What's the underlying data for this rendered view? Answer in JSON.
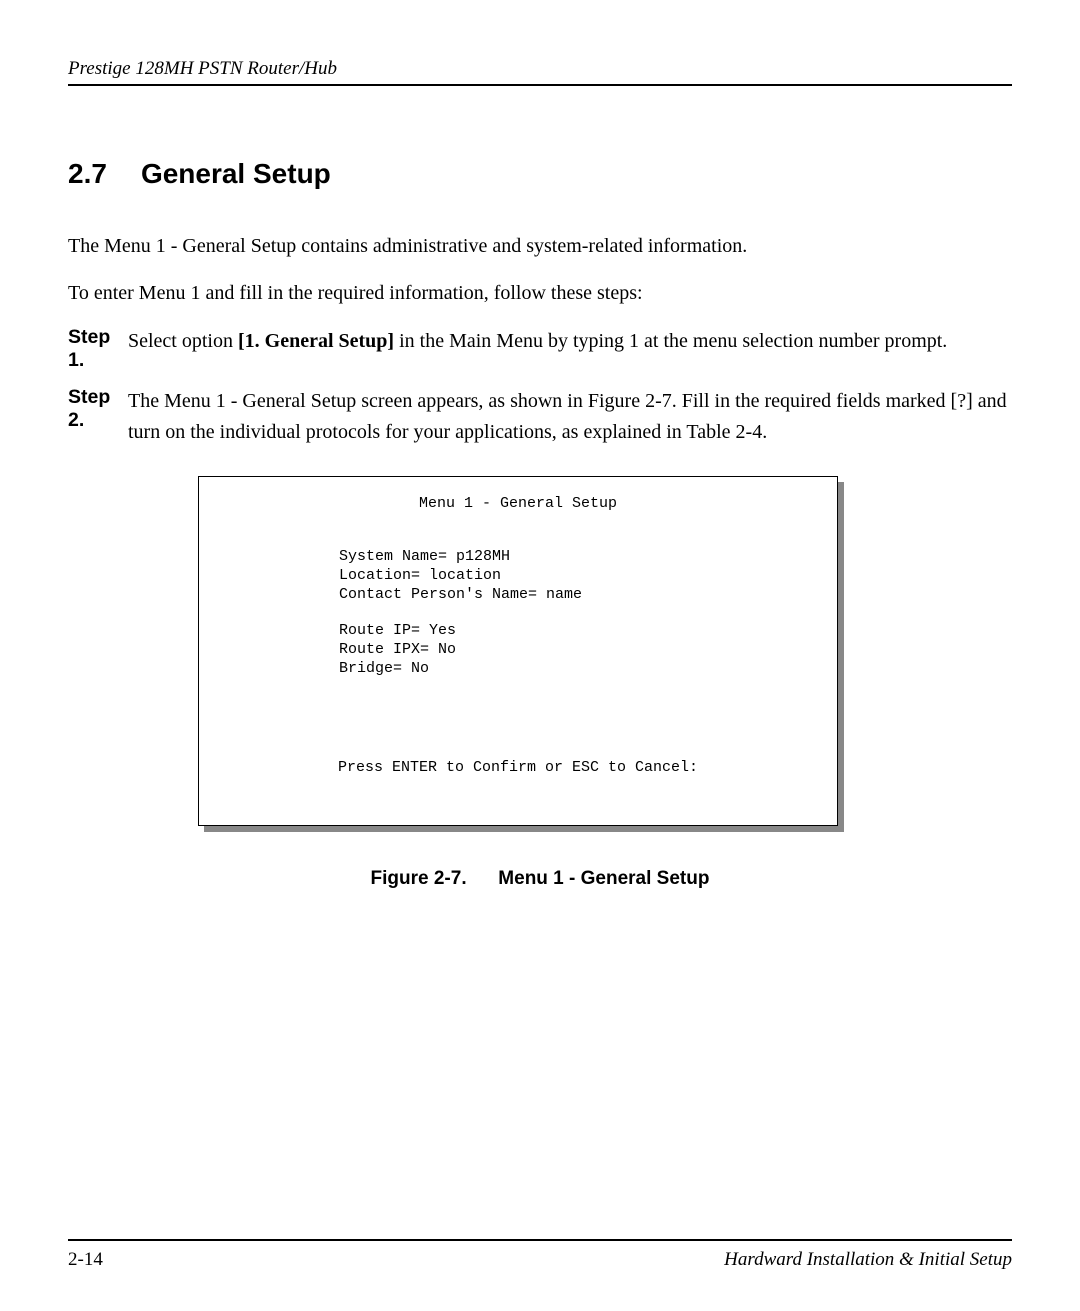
{
  "header": {
    "title": "Prestige 128MH  PSTN Router/Hub"
  },
  "section": {
    "number": "2.7",
    "title": "General Setup"
  },
  "paragraphs": {
    "intro1": "The Menu 1 - General Setup contains administrative and system-related information.",
    "intro2": "To enter Menu 1 and fill in the required information, follow these steps:"
  },
  "steps": [
    {
      "label": "Step 1.",
      "pre": "Select option ",
      "bold": "[1. General Setup]",
      "post": " in the Main Menu by typing 1 at the menu selection number prompt."
    },
    {
      "label": "Step 2.",
      "text": "The Menu 1 - General Setup screen appears, as shown in Figure 2-7. Fill in the required fields marked [?] and turn on the individual protocols for your applications, as explained in Table 2-4."
    }
  ],
  "terminal": {
    "title": "Menu 1 - General Setup",
    "block1": [
      "System Name= p128MH",
      "Location= location",
      "Contact Person's Name= name"
    ],
    "block2": [
      "Route IP= Yes",
      "Route IPX= No",
      "Bridge= No"
    ],
    "footer": "Press ENTER to Confirm or ESC to Cancel:"
  },
  "figure_caption": {
    "label": "Figure 2-7.",
    "title": "Menu 1 - General Setup"
  },
  "footer": {
    "page_number": "2-14",
    "section_title": "Hardward Installation & Initial Setup"
  }
}
